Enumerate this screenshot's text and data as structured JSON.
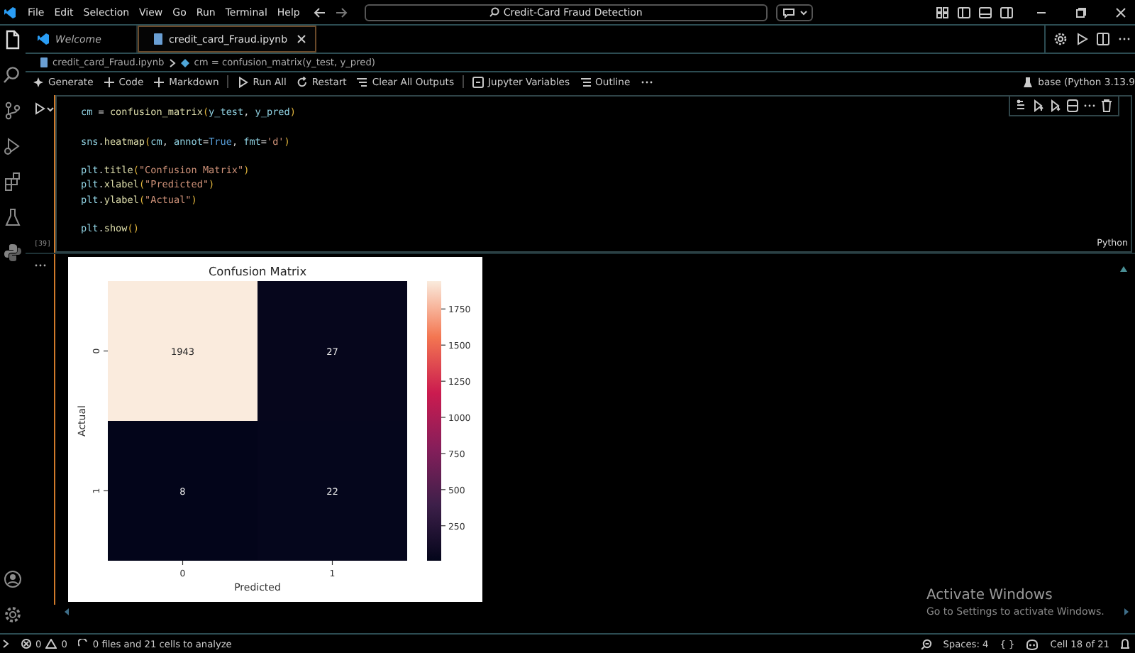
{
  "title_bar": {
    "menus": [
      "File",
      "Edit",
      "Selection",
      "View",
      "Go",
      "Run",
      "Terminal",
      "Help"
    ],
    "search": "Credit-Card Fraud Detection"
  },
  "activity_bar": {
    "items": [
      {
        "kind": "files",
        "selected": true
      },
      {
        "kind": "search",
        "selected": false
      },
      {
        "kind": "source-control",
        "selected": false
      },
      {
        "kind": "debug",
        "selected": false
      },
      {
        "kind": "extensions",
        "selected": false
      },
      {
        "kind": "testing",
        "selected": false
      },
      {
        "kind": "python",
        "selected": false
      }
    ]
  },
  "tabs": [
    {
      "label": "Welcome",
      "kind": "welcome",
      "selected": false,
      "italic": true
    },
    {
      "label": "credit_card_Fraud.ipynb",
      "kind": "notebook",
      "selected": true,
      "italic": false
    }
  ],
  "breadcrumb": [
    "credit_card_Fraud.ipynb",
    "cm = confusion_matrix(y_test, y_pred)"
  ],
  "toolbar": [
    {
      "kind": "sparkle",
      "label": "Generate"
    },
    {
      "kind": "plus",
      "label": "Code"
    },
    {
      "kind": "plus",
      "label": "Markdown"
    },
    {
      "kind": "divider"
    },
    {
      "kind": "run",
      "label": "Run All"
    },
    {
      "kind": "restart",
      "label": "Restart"
    },
    {
      "kind": "clear",
      "label": "Clear All Outputs"
    },
    {
      "kind": "divider"
    },
    {
      "kind": "variables",
      "label": "Jupyter Variables"
    },
    {
      "kind": "outline",
      "label": "Outline"
    },
    {
      "kind": "more"
    }
  ],
  "kernel": "base (Python 3.13.9",
  "cell": {
    "execution_count": "[39]",
    "language": "Python",
    "blocks": [
      [
        {
          "code": "cm = confusion_matrix(y_test, y_pred)"
        }
      ],
      [
        {
          "code": "sns.heatmap(cm, annot=True, fmt='d')"
        }
      ],
      [
        {
          "code": "plt.title(\"Confusion Matrix\")"
        },
        {
          "code": "plt.xlabel(\"Predicted\")"
        },
        {
          "code": "plt.ylabel(\"Actual\")"
        }
      ],
      [
        {
          "code": "plt.show()"
        }
      ]
    ]
  },
  "output": {
    "heatmap": {
      "title": "Confusion Matrix",
      "xlabel": "Predicted",
      "ylabel": "Actual",
      "x_ticks": [
        "0",
        "1"
      ],
      "y_ticks": [
        "0",
        "1"
      ],
      "cells": [
        [
          "1943",
          "27"
        ],
        [
          "8",
          "22"
        ]
      ],
      "colorbar_ticks": [
        "1750",
        "1500",
        "1250",
        "1000",
        "750",
        "500",
        "250"
      ]
    }
  },
  "watermark": {
    "title": "Activate Windows",
    "text": "Go to Settings to activate Windows."
  },
  "status_bar": {
    "errors": "0",
    "warnings": "0",
    "analysis": "0 files and 21 cells to analyze",
    "spaces": "Spaces: 4",
    "braces": "{ }",
    "cell": "Cell 18 of 21"
  }
}
